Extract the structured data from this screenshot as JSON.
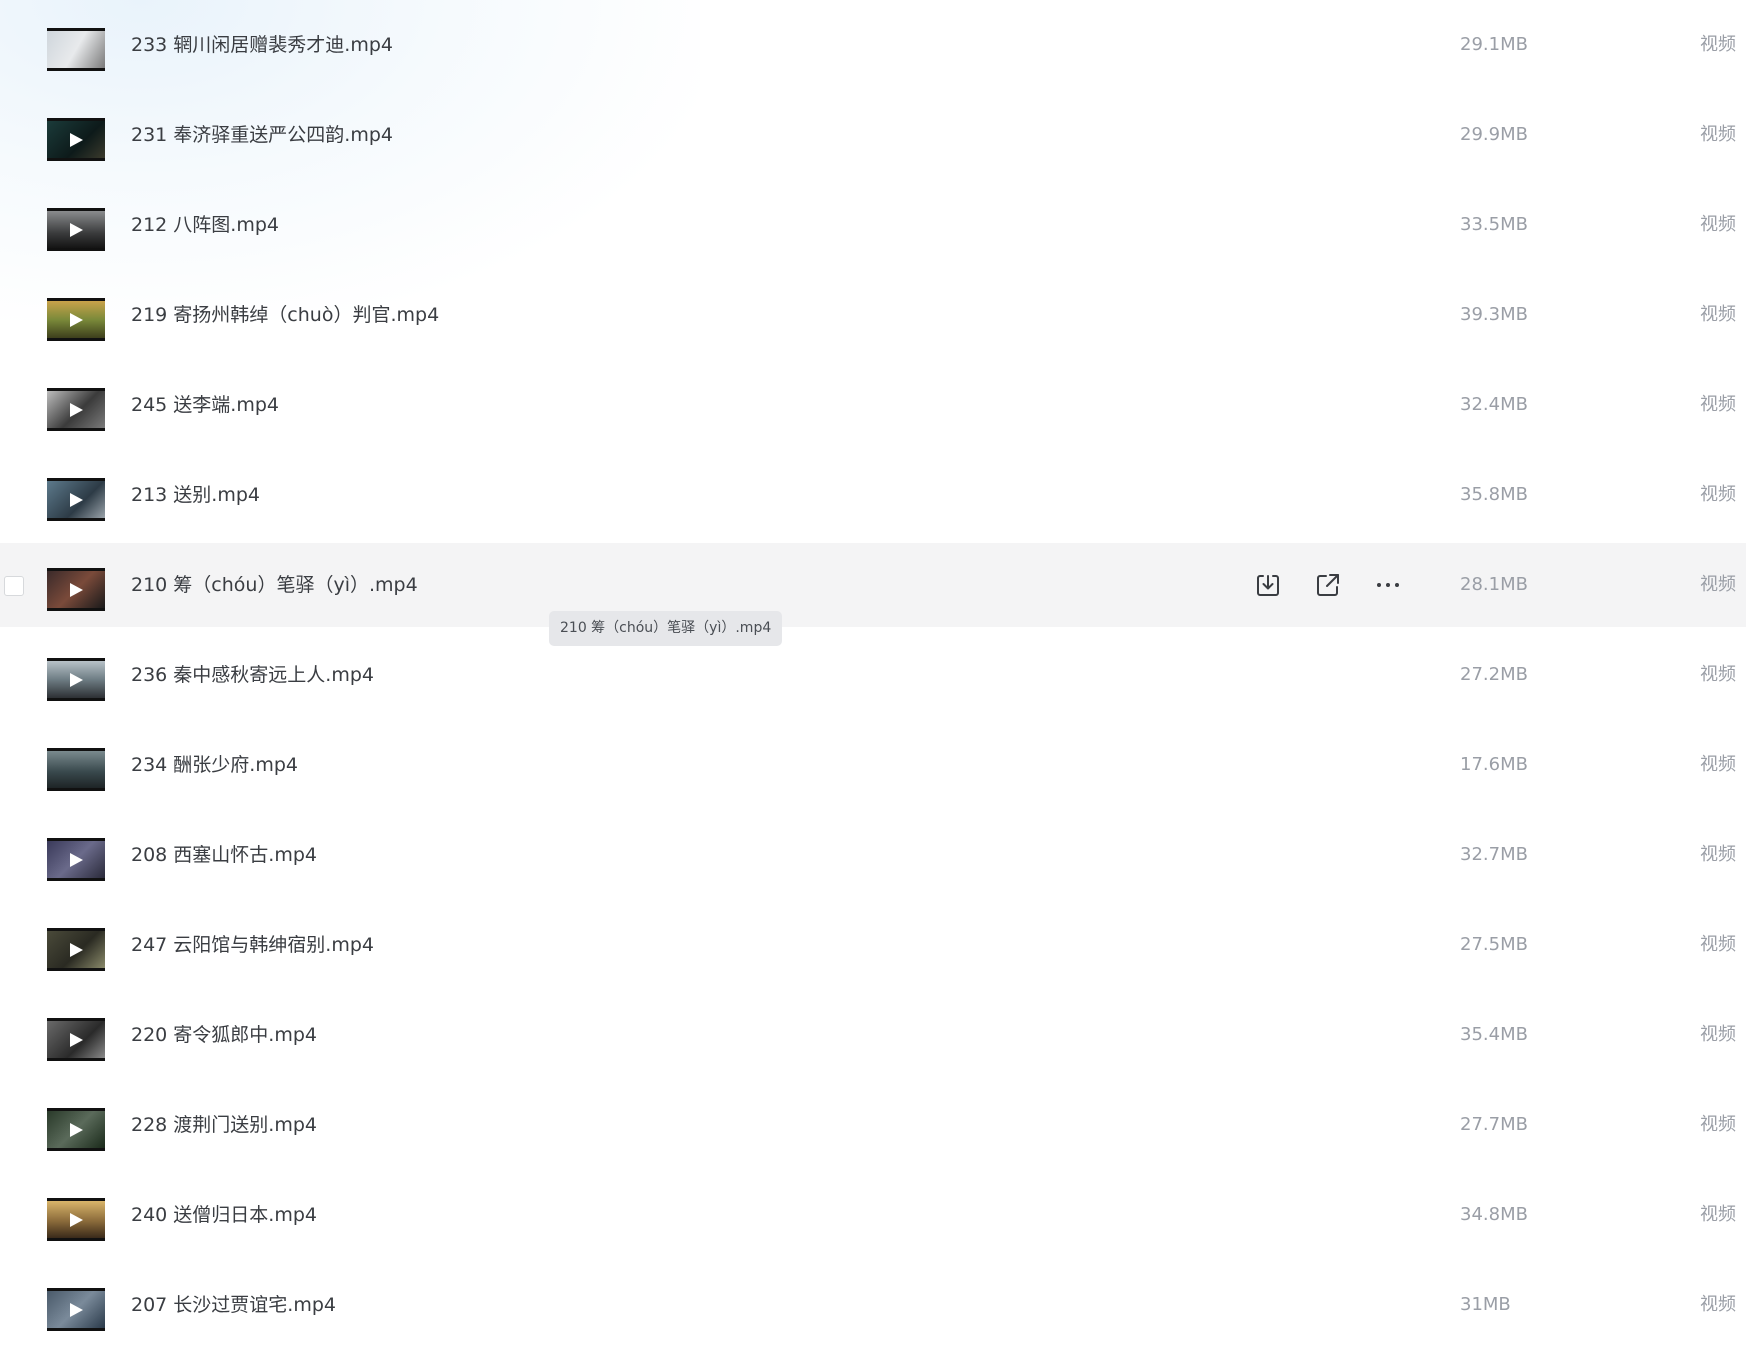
{
  "files": [
    {
      "name": "233 辋川闲居赠裴秀才迪.mp4",
      "size": "29.1MB",
      "type": "视频"
    },
    {
      "name": "231 奉济驿重送严公四韵.mp4",
      "size": "29.9MB",
      "type": "视频"
    },
    {
      "name": "212 八阵图.mp4",
      "size": "33.5MB",
      "type": "视频"
    },
    {
      "name": "219 寄扬州韩绰（chuò）判官.mp4",
      "size": "39.3MB",
      "type": "视频"
    },
    {
      "name": "245 送李端.mp4",
      "size": "32.4MB",
      "type": "视频"
    },
    {
      "name": "213 送别.mp4",
      "size": "35.8MB",
      "type": "视频"
    },
    {
      "name": "210 筹（chóu）笔驿（yì）.mp4",
      "size": "28.1MB",
      "type": "视频"
    },
    {
      "name": "236 秦中感秋寄远上人.mp4",
      "size": "27.2MB",
      "type": "视频"
    },
    {
      "name": "234 酬张少府.mp4",
      "size": "17.6MB",
      "type": "视频"
    },
    {
      "name": "208 西塞山怀古.mp4",
      "size": "32.7MB",
      "type": "视频"
    },
    {
      "name": "247 云阳馆与韩绅宿别.mp4",
      "size": "27.5MB",
      "type": "视频"
    },
    {
      "name": "220 寄令狐郎中.mp4",
      "size": "35.4MB",
      "type": "视频"
    },
    {
      "name": "228 渡荆门送别.mp4",
      "size": "27.7MB",
      "type": "视频"
    },
    {
      "name": "240 送僧归日本.mp4",
      "size": "34.8MB",
      "type": "视频"
    },
    {
      "name": "207 长沙过贾谊宅.mp4",
      "size": "31MB",
      "type": "视频"
    }
  ],
  "tooltip": "210 筹（chóu）笔驿（yì）.mp4",
  "icons": {
    "download": "download-icon",
    "share": "share-icon",
    "more": "more-icon"
  },
  "colors": {
    "hover_row": "#f4f4f5",
    "text": "#3a3d42",
    "muted": "#9a9ea6"
  }
}
